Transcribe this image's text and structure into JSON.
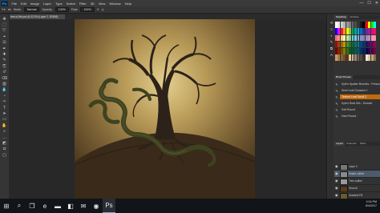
{
  "app": {
    "menu": [
      "File",
      "Edit",
      "Image",
      "Layer",
      "Type",
      "Select",
      "Filter",
      "3D",
      "View",
      "Window",
      "Help"
    ],
    "window_controls": [
      "—",
      "☐",
      "✕"
    ]
  },
  "options": {
    "mode_label": "Mode:",
    "mode_value": "Normal",
    "opacity_label": "Opacity:",
    "opacity_value": "100%",
    "flow_label": "Flow:",
    "flow_value": "100%"
  },
  "document": {
    "tab_title": "tree-of-life.psd @ 33.3% (Layer 2, RGB/8)"
  },
  "tools": [
    "move-icon",
    "marquee-icon",
    "lasso-icon",
    "quick-select-icon",
    "crop-icon",
    "eyedropper-icon",
    "healing-icon",
    "brush-icon",
    "stamp-icon",
    "history-brush-icon",
    "eraser-icon",
    "gradient-icon",
    "blur-icon",
    "dodge-icon",
    "pen-icon",
    "type-icon",
    "path-select-icon",
    "shape-icon",
    "hand-icon",
    "zoom-icon",
    "more-icon",
    "color-fg-bg-icon",
    "quick-mask-icon",
    "screen-mode-icon"
  ],
  "panels": {
    "swatch_tabs": [
      "Swatches",
      "Libraries"
    ],
    "swatch_colors": [
      "#ffffff",
      "#e6e6e6",
      "#cccccc",
      "#b3b3b3",
      "#999999",
      "#808080",
      "#666666",
      "#4d4d4d",
      "#333333",
      "#1a1a1a",
      "#000000",
      "#ff0000",
      "#ffff00",
      "#00ff00",
      "#00ffff",
      "#0000ff",
      "#ff00ff",
      "#ed1c24",
      "#f7941d",
      "#fff200",
      "#8dc63f",
      "#00a651",
      "#00a99d",
      "#00aeef",
      "#0072bc",
      "#2e3192",
      "#662d91",
      "#92278f",
      "#ec008c",
      "#ed145b",
      "#f26d7d",
      "#f69679",
      "#fdc689",
      "#fff799",
      "#c4df9b",
      "#82ca9c",
      "#7accc8",
      "#6dcff6",
      "#7da7d9",
      "#8393ca",
      "#8781bd",
      "#a186be",
      "#bd8cbf",
      "#f49ac1",
      "#f5989d",
      "#9e0b0f",
      "#a0410d",
      "#a36209",
      "#aba000",
      "#598527",
      "#197b30",
      "#007236",
      "#00746b",
      "#0076a3",
      "#004a80",
      "#003471",
      "#1b1464",
      "#440e62",
      "#630460",
      "#9e005d",
      "#790000",
      "#7b2e00",
      "#7d4900",
      "#827b00",
      "#406618",
      "#005e20",
      "#005826",
      "#005952",
      "#005b7f",
      "#003663",
      "#002157",
      "#0d004c",
      "#32004b",
      "#4b0049",
      "#7b0046",
      "#c69c6d",
      "#a67c52",
      "#8c6239",
      "#754c24",
      "#603813",
      "#e6c79c",
      "#c7b299",
      "#998675",
      "#736357",
      "#534741",
      "#362f2d",
      "#f2e8d5",
      "#d9c9a3",
      "#bfa77a",
      "#8a6f3f"
    ],
    "brush_panel_title": "Brush Presets",
    "brushes": [
      {
        "icon": "✎",
        "label": "Kyle's Spatter Brushes - Pressure Control 2"
      },
      {
        "icon": "✎",
        "label": "Semi Leaf Gouache 1"
      },
      {
        "icon": "✎",
        "label": "Texture Leaf Scroll 2"
      },
      {
        "icon": "✎",
        "label": "Kyle's Real Oils - Smooth"
      },
      {
        "icon": "✎",
        "label": "Soft Round"
      },
      {
        "icon": "✎",
        "label": "Hard Round"
      }
    ],
    "layer_tabs": [
      "Layers",
      "Channels",
      "Paths"
    ],
    "layers": [
      {
        "name": "Layer 4",
        "thumb": "#777777"
      },
      {
        "name": "Snake outline",
        "thumb": "#8a8a8a"
      },
      {
        "name": "Tree outline",
        "thumb": "#999999"
      },
      {
        "name": "Ground",
        "thumb": "#5a3a1a"
      },
      {
        "name": "Gradient Fill",
        "thumb": "#6b5a2e"
      }
    ]
  },
  "taskbar": {
    "items": [
      {
        "icon": "windows-icon",
        "glyph": "⊞"
      },
      {
        "icon": "search-icon",
        "glyph": "⌕"
      },
      {
        "icon": "task-view-icon",
        "glyph": "❐"
      },
      {
        "icon": "edge-icon",
        "glyph": "e"
      },
      {
        "icon": "folder-icon",
        "glyph": "▬"
      },
      {
        "icon": "store-icon",
        "glyph": "◧"
      },
      {
        "icon": "mail-icon",
        "glyph": "✉"
      },
      {
        "icon": "chrome-icon",
        "glyph": "◉"
      },
      {
        "icon": "photoshop-icon",
        "glyph": "Ps"
      }
    ],
    "time": "4:04 PM",
    "date": "6/4/2017"
  }
}
